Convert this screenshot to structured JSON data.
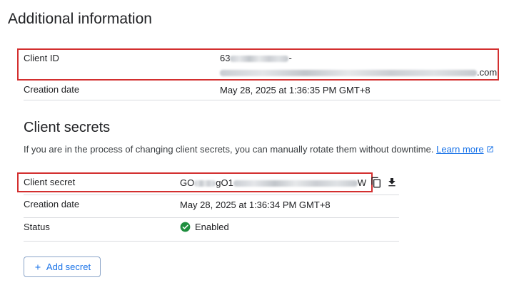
{
  "section_title": "Additional information",
  "client": {
    "id_label": "Client ID",
    "id_prefix": "63",
    "id_dash": "-",
    "id_suffix": ".com",
    "creation_label": "Creation date",
    "creation_value": "May 28, 2025 at 1:36:35 PM GMT+8"
  },
  "secrets": {
    "title": "Client secrets",
    "description": "If you are in the process of changing client secrets, you can manually rotate them without downtime.",
    "learn_more": "Learn more",
    "secret_label": "Client secret",
    "secret_start": "GO",
    "secret_mid": "gO1",
    "secret_end": "W",
    "creation_label": "Creation date",
    "creation_value": "May 28, 2025 at 1:36:34 PM GMT+8",
    "status_label": "Status",
    "status_value": "Enabled",
    "add_button": "Add secret"
  },
  "colors": {
    "accent": "#1a73e8",
    "highlight_border": "#d32f2f",
    "enabled": "#1e8e3e"
  },
  "icons": [
    "copy-icon",
    "download-icon",
    "check-circle-icon",
    "external-link-icon",
    "plus-icon"
  ]
}
